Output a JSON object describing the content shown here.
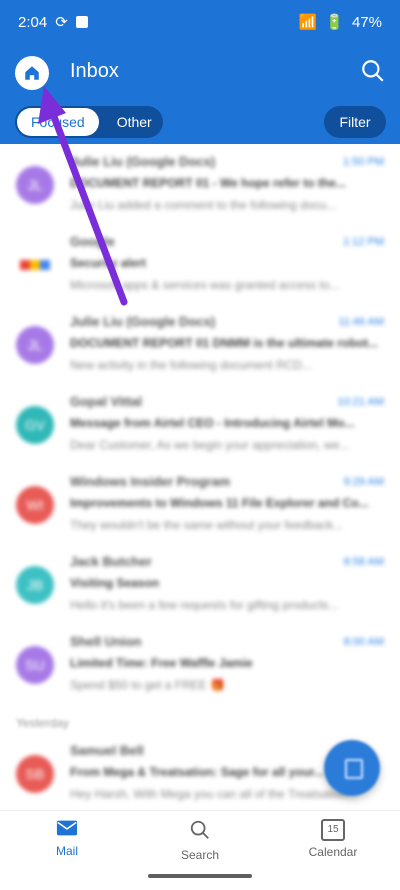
{
  "status": {
    "time": "2:04",
    "battery": "47%"
  },
  "header": {
    "title": "Inbox",
    "tabs": [
      "Focused",
      "Other"
    ],
    "filter": "Filter"
  },
  "emails": [
    {
      "sender": "Julie Liu (Google Docs)",
      "time": "1:50 PM",
      "subject": "DOCUMENT REPORT 01 - We hope refer to the...",
      "preview": "Julie Liu added a comment to the following docu...",
      "avatar": "JL",
      "color": "#a779e6"
    },
    {
      "sender": "Google",
      "time": "1:12 PM",
      "subject": "Security alert",
      "preview": "Microsoft apps & services was granted access to...",
      "avatar": "G",
      "color": "#ffffff"
    },
    {
      "sender": "Julie Liu (Google Docs)",
      "time": "11:46 AM",
      "subject": "DOCUMENT REPORT 01 DNMM is the ultimate robot...",
      "preview": "New activity in the following document RCD...",
      "avatar": "JL",
      "color": "#a779e6"
    },
    {
      "sender": "Gopal Vittal",
      "time": "10:21 AM",
      "subject": "Message from Airtel CEO - Introducing Airtel Mo...",
      "preview": "Dear Customer, As we begin your appreciation, we...",
      "avatar": "GV",
      "color": "#30b7b7"
    },
    {
      "sender": "Windows Insider Program",
      "time": "9:29 AM",
      "subject": "Improvements to Windows 11 File Explorer and Co...",
      "preview": "They wouldn't be the same without your feedback...",
      "avatar": "WI",
      "color": "#e85b57"
    },
    {
      "sender": "Jack Butcher",
      "time": "8:58 AM",
      "subject": "Visiting Season",
      "preview": "Hello it's been a few requests for gifting products...",
      "avatar": "JB",
      "color": "#3ec1c4"
    },
    {
      "sender": "Shell Union",
      "time": "8:00 AM",
      "subject": "Limited Time: Free Waffle Jamie",
      "preview": "Spend $50 to get a FREE 🎁",
      "avatar": "SU",
      "color": "#a779e6"
    },
    {
      "sender": "Samuel Bell",
      "time": "",
      "subject": "From Mega & Treatsation: Sage for all your...",
      "preview": "Hey Harsh, With Mega you can all of the Treatsation...",
      "avatar": "SB",
      "color": "#e85b57"
    }
  ],
  "section_label": "Yesterday",
  "nav": {
    "mail": "Mail",
    "search": "Search",
    "calendar": "Calendar",
    "calendar_day": "15"
  },
  "colors": {
    "brand": "#1d73d6",
    "arrow": "#7a2ed9"
  },
  "icons": [
    "home-icon",
    "search-icon",
    "mail-icon",
    "calendar-icon",
    "wifi-icon",
    "battery-icon",
    "compose-icon"
  ]
}
